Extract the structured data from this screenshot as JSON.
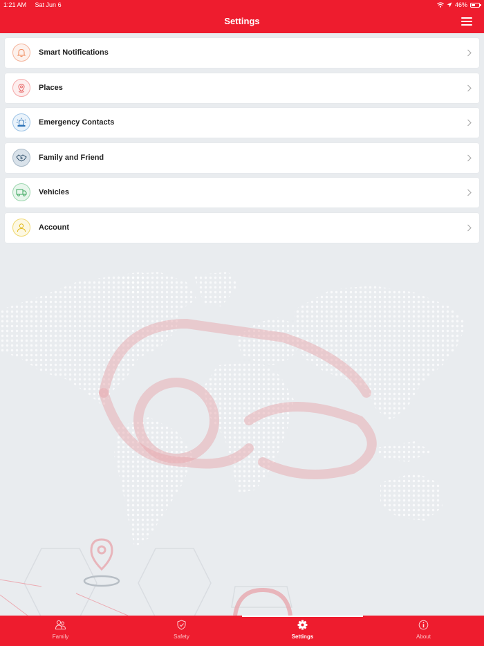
{
  "status_bar": {
    "time": "1:21 AM",
    "date": "Sat Jun 6",
    "battery": "46%",
    "battery_level": 0.46
  },
  "header": {
    "title": "Settings",
    "menu_icon": "hamburger-menu-icon"
  },
  "menu": {
    "items": [
      {
        "label": "Smart Notifications",
        "icon": "bell-icon",
        "color": "#f3a37a"
      },
      {
        "label": "Places",
        "icon": "location-pin-icon",
        "color": "#f28b8b"
      },
      {
        "label": "Emergency Contacts",
        "icon": "siren-icon",
        "color": "#3a7fc4"
      },
      {
        "label": "Family and Friend",
        "icon": "handshake-icon",
        "color": "#3f5f7a"
      },
      {
        "label": "Vehicles",
        "icon": "truck-icon",
        "color": "#47b66a"
      },
      {
        "label": "Account",
        "icon": "user-icon",
        "color": "#e6c22a"
      }
    ]
  },
  "tabs": [
    {
      "label": "Family",
      "icon": "family-icon"
    },
    {
      "label": "Safety",
      "icon": "shield-icon"
    },
    {
      "label": "Settings",
      "icon": "gear-icon",
      "active": true
    },
    {
      "label": "About",
      "icon": "info-icon"
    }
  ],
  "colors": {
    "brand": "#ee1c2e",
    "background": "#e9ecef"
  }
}
